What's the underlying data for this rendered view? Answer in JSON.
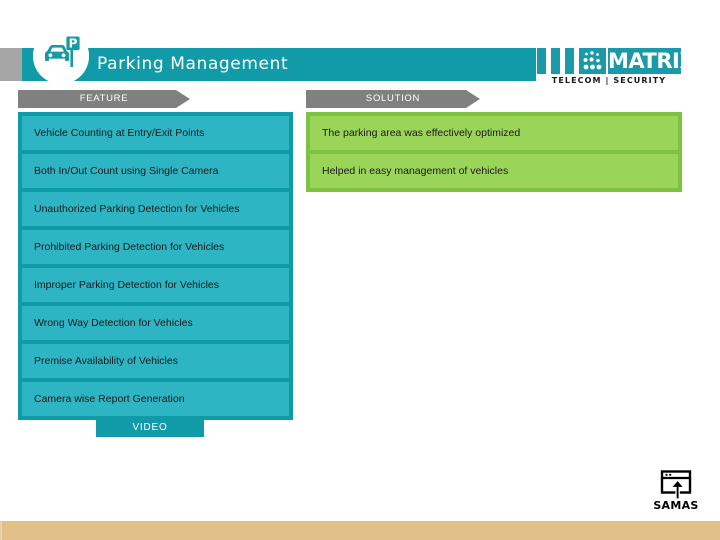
{
  "header": {
    "title": "Parking Management",
    "logo_icon": "car-parking-sign-icon"
  },
  "brand": {
    "wordmark": "MATRIX",
    "tagline": "TELECOM | SECURITY",
    "accent_color": "#1a9aa8"
  },
  "columns": {
    "feature_label": "FEATURE",
    "solution_label": "SOLUTION"
  },
  "features": [
    {
      "text": "Vehicle Counting at Entry/Exit Points"
    },
    {
      "text": "Both In/Out Count using Single Camera"
    },
    {
      "text": "Unauthorized Parking Detection for Vehicles"
    },
    {
      "text": "Prohibited Parking Detection for Vehicles"
    },
    {
      "text": "Improper Parking Detection for Vehicles"
    },
    {
      "text": "Wrong Way Detection for Vehicles"
    },
    {
      "text": "Premise Availability of Vehicles"
    },
    {
      "text": "Camera wise Report Generation"
    }
  ],
  "solutions": [
    {
      "text": "The parking area was effectively optimized"
    },
    {
      "text": "Helped in easy management of vehicles"
    }
  ],
  "video_button": {
    "label": "VIDEO"
  },
  "footer": {
    "samas_label": "SAMAS",
    "samas_icon": "window-upload-arrow-icon"
  },
  "colors": {
    "teal_header": "#119aa8",
    "teal_panel": "#0e9aa7",
    "teal_item": "#2db5c4",
    "green_panel": "#7dc242",
    "green_item": "#9ad459",
    "gray_tab": "#808080",
    "bottom_strip": "#e2c089"
  }
}
